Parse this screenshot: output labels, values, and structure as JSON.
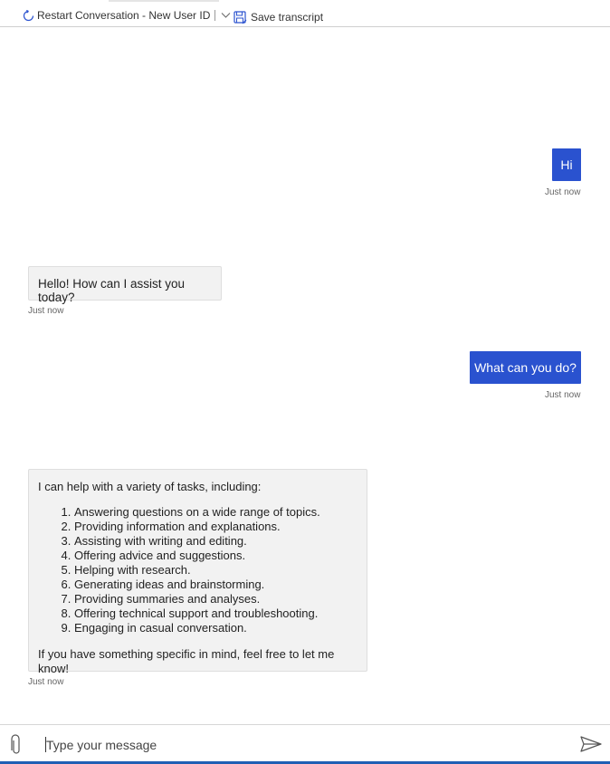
{
  "toolbar": {
    "restart_label": "Restart Conversation - New User ID",
    "save_label": "Save transcript"
  },
  "messages": [
    {
      "from": "user",
      "text": "Hi",
      "time": "Just now"
    },
    {
      "from": "bot",
      "text": "Hello! How can I assist you today?",
      "time": "Just now"
    },
    {
      "from": "user",
      "text": "What can you do?",
      "time": "Just now"
    },
    {
      "from": "bot",
      "intro": "I can help with a variety of tasks, including:",
      "items": [
        "Answering questions on a wide range of topics.",
        "Providing information and explanations.",
        "Assisting with writing and editing.",
        "Offering advice and suggestions.",
        "Helping with research.",
        "Generating ideas and brainstorming.",
        "Providing summaries and analyses.",
        "Offering technical support and troubleshooting.",
        "Engaging in casual conversation."
      ],
      "outro": "If you have something specific in mind, feel free to let me know!",
      "time": "Just now"
    }
  ],
  "composer": {
    "placeholder": "Type your message"
  },
  "colors": {
    "user_bubble": "#2a52cf",
    "bot_bubble": "#f2f2f2",
    "accent_bar": "#1f5fb4"
  }
}
